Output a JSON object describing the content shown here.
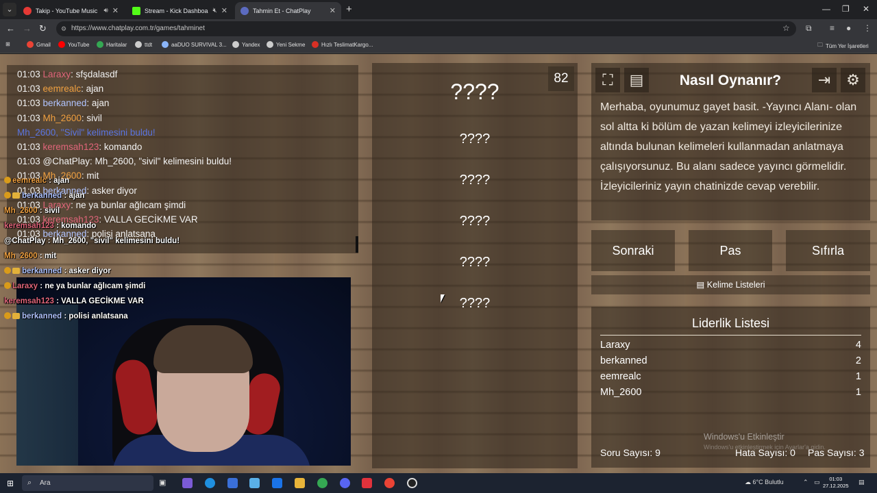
{
  "browser": {
    "tabs": [
      {
        "label": "Takip - YouTube Music",
        "color": "#e53935",
        "active": false,
        "muted": false
      },
      {
        "label": "Stream - Kick Dashboard",
        "color": "#53fc18",
        "active": false,
        "muted": true
      },
      {
        "label": "Tahmin Et - ChatPlay",
        "color": "#5c6bc0",
        "active": true,
        "muted": false
      }
    ],
    "url": "https://www.chatplay.com.tr/games/tahminet",
    "bookmarks": [
      {
        "label": "Gmail",
        "color": "#ea4335"
      },
      {
        "label": "YouTube",
        "color": "#ff0000"
      },
      {
        "label": "Haritalar",
        "color": "#34a853"
      },
      {
        "label": "ttdt",
        "color": "#cccccc"
      },
      {
        "label": "aaDUO SURVIVAL 3...",
        "color": "#8ab4f8"
      },
      {
        "label": "Yandex",
        "color": "#cccccc"
      },
      {
        "label": "Yeni Sekme",
        "color": "#cccccc"
      },
      {
        "label": "Hızlı TeslimatKargo...",
        "color": "#d93025"
      }
    ],
    "all_bookmarks": "Tüm Yer İşaretleri"
  },
  "chat": {
    "lines": [
      {
        "time": "01:03",
        "user": "Laraxy",
        "user_color": "#e0657a",
        "msg": "sfşdalasdf"
      },
      {
        "time": "01:03",
        "user": "eemrealc",
        "user_color": "#f0a040",
        "msg": "ajan"
      },
      {
        "time": "01:03",
        "user": "berkanned",
        "user_color": "#b0c4ff",
        "msg": "ajan"
      },
      {
        "time": "01:03",
        "user": "Mh_2600",
        "user_color": "#f0a040",
        "msg": "sivil"
      },
      {
        "time": "",
        "user": "",
        "user_color": "",
        "msg": "Mh_2600, \"Sivil\" kelimesini buldu!",
        "found": true
      },
      {
        "time": "01:03",
        "user": "keremsah123",
        "user_color": "#e0657a",
        "msg": "komando"
      },
      {
        "time": "01:03",
        "user": "@ChatPlay",
        "user_color": "#f3f3f3",
        "msg": "Mh_2600, \"sivil\" kelimesini buldu!"
      },
      {
        "time": "01:03",
        "user": "Mh_2600",
        "user_color": "#f0a040",
        "msg": "mit"
      },
      {
        "time": "01:03",
        "user": "berkanned",
        "user_color": "#b0c4ff",
        "msg": "asker diyor"
      },
      {
        "time": "01:03",
        "user": "Laraxy",
        "user_color": "#e0657a",
        "msg": "ne ya bunlar ağlıcam şimdi"
      },
      {
        "time": "01:03",
        "user": "keremsah123",
        "user_color": "#e0657a",
        "msg": "VALLA GECİKME VAR"
      },
      {
        "time": "01:03",
        "user": "berkanned",
        "user_color": "#b0c4ff",
        "msg": "polisi anlatsana"
      }
    ]
  },
  "overlay": {
    "lines": [
      {
        "user": "eemrealc",
        "user_color": "#f0a040",
        "msg": "ajan",
        "badge": "warn"
      },
      {
        "user": "berkanned",
        "user_color": "#b0c4ff",
        "msg": "ajan",
        "badge": "both"
      },
      {
        "user": "Mh_2600",
        "user_color": "#f0a040",
        "msg": "sivil",
        "badge": ""
      },
      {
        "user": "keremsah123",
        "user_color": "#e0657a",
        "msg": "komando",
        "badge": ""
      },
      {
        "user": "@ChatPlay",
        "user_color": "#ffffff",
        "msg": "Mh_2600, \"sivil\" kelimesini buldu!",
        "badge": ""
      },
      {
        "user": "Mh_2600",
        "user_color": "#f0a040",
        "msg": "mit",
        "badge": ""
      },
      {
        "user": "berkanned",
        "user_color": "#b0c4ff",
        "msg": "asker diyor",
        "badge": "both"
      },
      {
        "user": "Laraxy",
        "user_color": "#e0657a",
        "msg": "ne ya bunlar ağlıcam şimdi",
        "badge": "warn"
      },
      {
        "user": "keremsah123",
        "user_color": "#e0657a",
        "msg": "VALLA GECİKME VAR",
        "badge": ""
      },
      {
        "user": "berkanned",
        "user_color": "#b0c4ff",
        "msg": "polisi anlatsana",
        "badge": "both"
      }
    ]
  },
  "game": {
    "counter": "82",
    "main_word": "????",
    "words": [
      "????",
      "????",
      "????",
      "????",
      "????"
    ]
  },
  "howto": {
    "title": "Nasıl Oynanır?",
    "text": "Merhaba, oyunumuz gayet basit. -Yayıncı Alanı- olan sol altta ki bölüm de yazan kelimeyi izleyicilerinize altında bulunan kelimeleri kullanmadan anlatmaya çalışıyorsunuz. Bu alanı sadece yayıncı görmelidir. İzleyicileriniz yayın chatinizde cevap verebilir.",
    "icons": [
      "fullscreen-icon",
      "notes-icon",
      "exit-icon",
      "settings-icon"
    ]
  },
  "actions": {
    "next": "Sonraki",
    "pass": "Pas",
    "reset": "Sıfırla",
    "word_lists": "Kelime Listeleri"
  },
  "leaderboard": {
    "title": "Liderlik Listesi",
    "rows": [
      {
        "name": "Laraxy",
        "score": "4"
      },
      {
        "name": "berkanned",
        "score": "2"
      },
      {
        "name": "eemrealc",
        "score": "1"
      },
      {
        "name": "Mh_2600",
        "score": "1"
      }
    ]
  },
  "stats": {
    "questions": "Soru Sayısı: 9",
    "errors": "Hata Sayısı: 0",
    "passes": "Pas Sayısı: 3"
  },
  "watermark": {
    "line1": "Windows'u Etkinleştir",
    "line2": "Windows'u etkinleştirmek için Ayarlar'a gidin."
  },
  "taskbar": {
    "search_placeholder": "Ara",
    "weather": "6°C  Bulutlu",
    "time": "01:03",
    "date": "27.12.2025"
  }
}
